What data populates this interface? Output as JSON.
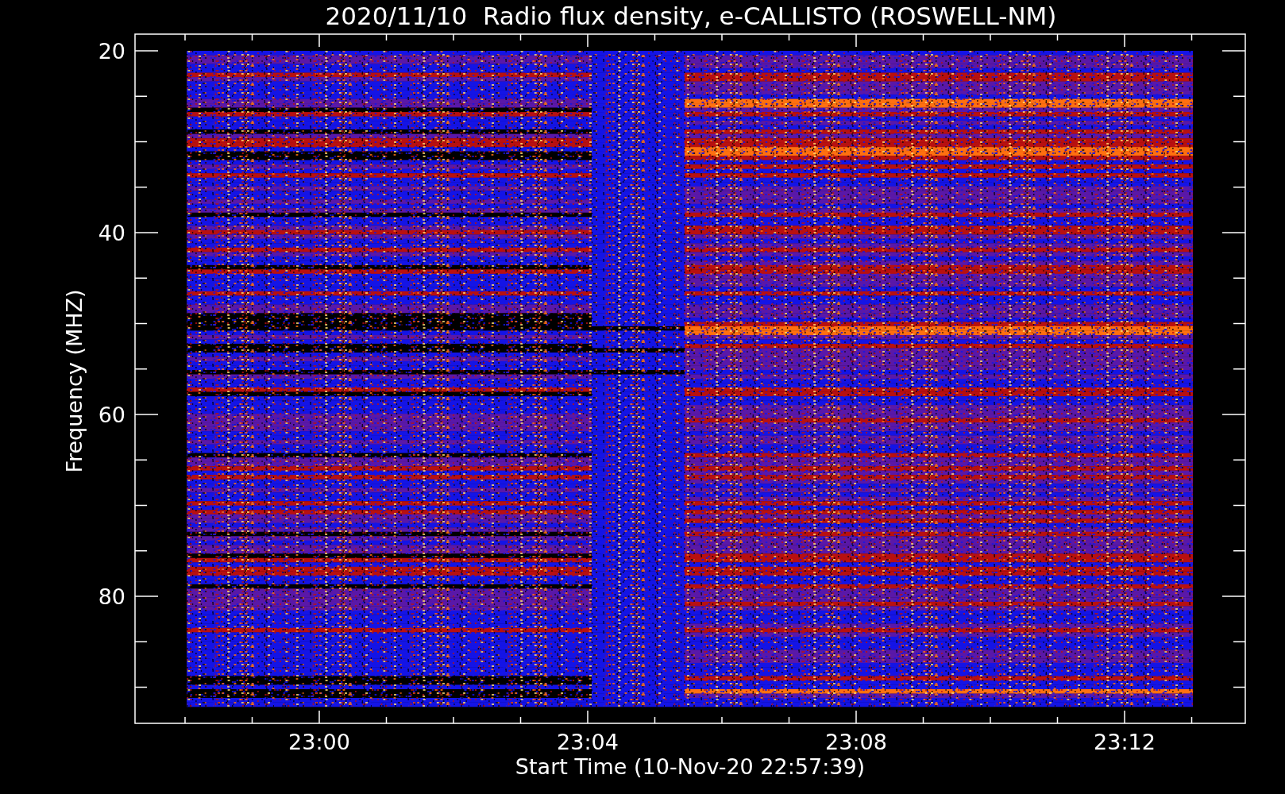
{
  "title": "2020/11/10  Radio flux density, e-CALLISTO (ROSWELL-NM)",
  "y_axis": {
    "label": "Frequency (MHZ)",
    "ticks": [
      "20",
      "40",
      "60",
      "80"
    ]
  },
  "x_axis": {
    "label": "Start Time (10-Nov-20 22:57:39)",
    "ticks": [
      "23:00",
      "23:04",
      "23:08",
      "23:12"
    ]
  }
}
